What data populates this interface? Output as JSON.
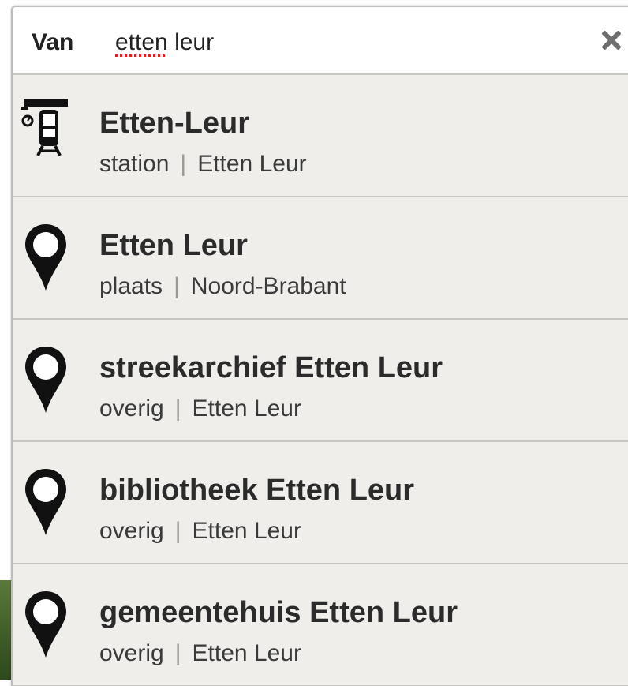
{
  "search": {
    "label": "Van",
    "value": "etten leur",
    "value_word1": "etten",
    "value_word2": " leur",
    "clear_icon": "close-icon"
  },
  "results": [
    {
      "title": "Etten-Leur",
      "type": "station",
      "region": "Etten Leur",
      "icon": "train-station-icon"
    },
    {
      "title": "Etten Leur",
      "type": "plaats",
      "region": "Noord-Brabant",
      "icon": "map-pin-icon"
    },
    {
      "title": "streekarchief Etten Leur",
      "type": "overig",
      "region": "Etten Leur",
      "icon": "map-pin-icon"
    },
    {
      "title": "bibliotheek Etten Leur",
      "type": "overig",
      "region": "Etten Leur",
      "icon": "map-pin-icon"
    },
    {
      "title": "gemeentehuis Etten Leur",
      "type": "overig",
      "region": "Etten Leur",
      "icon": "map-pin-icon"
    }
  ],
  "separator": "|",
  "colors": {
    "panel_bg": "#efeeeb",
    "input_bg": "#ffffff",
    "text": "#2b2b2b",
    "divider": "#c9c7c2"
  }
}
